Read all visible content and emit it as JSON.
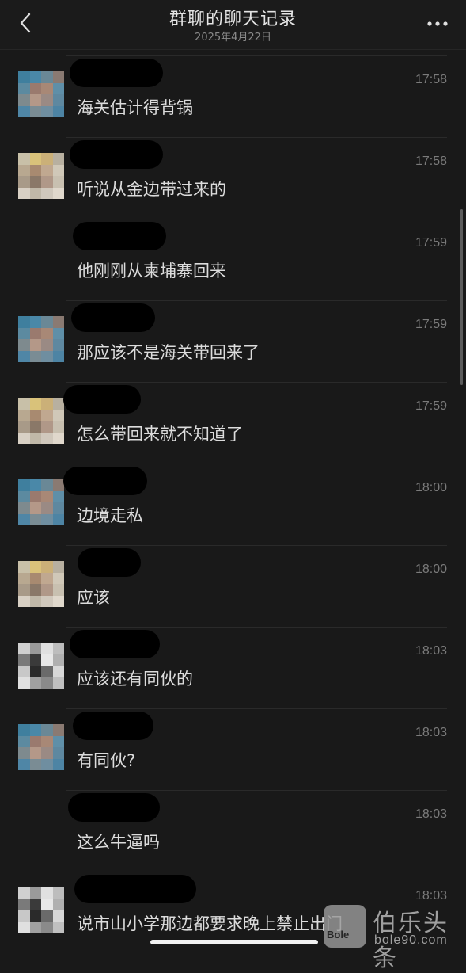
{
  "header": {
    "title": "群聊的聊天记录",
    "date": "2025年4月22日",
    "back_icon": "chevron-left-icon",
    "more_icon": "more-dots-icon"
  },
  "messages": [
    {
      "time": "17:58",
      "text": "海关估计得背锅",
      "avatar": "blue"
    },
    {
      "time": "17:58",
      "text": "听说从金边带过来的",
      "avatar": "cream"
    },
    {
      "time": "17:59",
      "text": "他刚刚从柬埔寨回来",
      "avatar": "none"
    },
    {
      "time": "17:59",
      "text": "那应该不是海关带回来了",
      "avatar": "blue"
    },
    {
      "time": "17:59",
      "text": "怎么带回来就不知道了",
      "avatar": "cream"
    },
    {
      "time": "18:00",
      "text": "边境走私",
      "avatar": "blue"
    },
    {
      "time": "18:00",
      "text": "应该",
      "avatar": "cream"
    },
    {
      "time": "18:03",
      "text": "应该还有同伙的",
      "avatar": "gray"
    },
    {
      "time": "18:03",
      "text": "有同伙?",
      "avatar": "blue"
    },
    {
      "time": "18:03",
      "text": "这么牛逼吗",
      "avatar": "none"
    },
    {
      "time": "18:03",
      "text": "说市山小学那边都要求晚上禁止出门",
      "avatar": "gray"
    }
  ],
  "watermark": {
    "logo_text": "Bole",
    "name": "伯乐头条",
    "domain": "bole90.com"
  },
  "colors": {
    "background": "#191919",
    "text": "#dcdcdc",
    "time": "#7b7b7b"
  }
}
